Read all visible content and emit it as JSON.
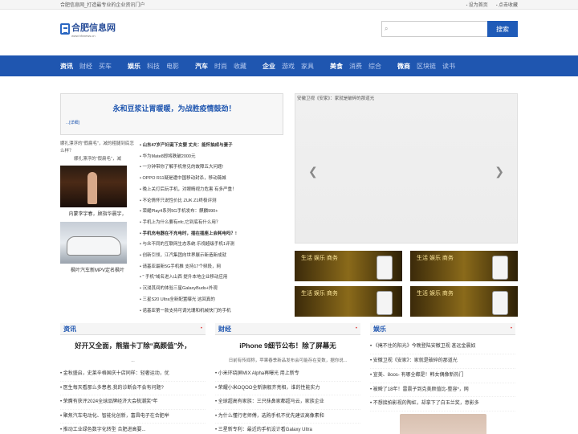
{
  "topbar": {
    "slogan": "合肥信息网_打造最专业的企业资讯门户",
    "set_home": "设为首页",
    "bookmark": "点击收藏"
  },
  "logo": {
    "name": "合肥信息网",
    "url": "www.hfxnews.cn"
  },
  "search": {
    "placeholder": "",
    "button": "搜索"
  },
  "nav": [
    {
      "main": "资讯",
      "subs": [
        "财经",
        "买车"
      ]
    },
    {
      "main": "娱乐",
      "subs": [
        "科技",
        "电影"
      ]
    },
    {
      "main": "汽车",
      "subs": [
        "时尚",
        "收藏"
      ]
    },
    {
      "main": "企业",
      "subs": [
        "游戏",
        "家具"
      ]
    },
    {
      "main": "美食",
      "subs": [
        "消费",
        "综合"
      ]
    },
    {
      "main": "微商",
      "subs": [
        "区块链",
        "读书"
      ]
    }
  ],
  "promo": {
    "title": "永和豆浆让胃暖暖，为战胜疫情鼓劲！",
    "more": "...[详细]"
  },
  "thumbs": {
    "top_caption": "娜扎漂浮的\"假扁毛\"，减的粗腿到底怎么样？",
    "top_caption2": "娜扎漂浮的\"假扁毛\"，减",
    "items": [
      {
        "caption": "内蒙李宇春，顾指华晨宇，"
      },
      {
        "caption": "枫叶汽车新MPV定名枫叶"
      }
    ]
  },
  "news_list": [
    {
      "text": "山东47岁产妇诞下女婴 丈夫：能怀抽成与妻子",
      "bold": true
    },
    {
      "text": "华为Mate8即将跌破2000元",
      "bold": false
    },
    {
      "text": "一分钟带你了解手机常见的故障五大问题!",
      "bold": false
    },
    {
      "text": "OPPO R11疑是遭中国移动封杀，移动薇城",
      "bold": false
    },
    {
      "text": "晚上关灯后玩手机，对眼睛视力危害 有多严重！",
      "bold": false
    },
    {
      "text": "不论情怀只说性价比 ZUK Z1终极评测",
      "bold": false
    },
    {
      "text": "荣耀Play4系列5G手机发布：麒麟990+",
      "bold": false
    },
    {
      "text": "手机上为什么要有nfc,它到底有什么用？",
      "bold": false
    },
    {
      "text": "手机充电器在不充电时，插在插座上会耗电吗？!",
      "bold": true
    },
    {
      "text": "与众不同的互联网生态系统 乐视超级手机1评测",
      "bold": false
    },
    {
      "text": "创新引领，江汽集团向世界展示新造新成就",
      "bold": false
    },
    {
      "text": "请基亚最新5G手机推 支持17个频段，网",
      "bold": false
    },
    {
      "text": "\" 手机\"域名进入山西 提升本地企业移动应用",
      "bold": false
    },
    {
      "text": "沉浸其间的体验三星GalaxyBuds+外观",
      "bold": false
    },
    {
      "text": "三星S20 Ultra全新配置曝光 这回真的",
      "bold": false
    },
    {
      "text": "诺基亚第一款支持可调光珊和机械快门的手机",
      "bold": false
    }
  ],
  "slider": {
    "caption": "安徽卫视《安家》：家就是破碎的那道光"
  },
  "ads": [
    {
      "text": "生活 娱乐 商务"
    },
    {
      "text": "生活 娱乐 商务"
    },
    {
      "text": "生活 娱乐 商务"
    },
    {
      "text": "生活 娱乐 商务"
    }
  ],
  "sections": [
    {
      "title": "资讯",
      "feature": "好开又全面，熊猫卡丁除“高颜值”外，",
      "sub": "...",
      "items": [
        "金秋盛启，史莱辛格国庆十店同样：轻奢运动，优",
        "医生每天看那么多患者,我的诊断会不会有问题?",
        "荣膺有获评2024全球品牌经济大会梳潮奖*年",
        "聚焦汽车电动化、智能化创新，富昌电子在合肥举",
        "推动工业绿色数字化转型 合肥进高要..."
      ]
    },
    {
      "title": "财经",
      "feature": "iPhone 9细节公布！除了屏幕无",
      "sub": "日前有传闻称，苹果春季新品发布会可能存在变数，据你说...",
      "items": [
        "小米环绕屏MIX Alpha再曝光 用上新专",
        "荣耀小米OQOO全新旗舰齐亮相，谁的性能实力",
        "全球超高有家族：三只抹鼻家都超马云，家族企业",
        "为什么懂行老师傅，选购手机不优先建议高像素和",
        "三星新专利：最近的手机设计看Galaxy Ultra"
      ]
    },
    {
      "title": "娱乐",
      "feature": "",
      "sub": "",
      "items": [
        "《掩不住的阳光》今晚登陆安徽卫视 甚远金晨奴",
        "安徽卫视《安家》：家就是破碎的那道光",
        "宣美、8oos- 有哪全都是！韩女偶像新热门",
        "被瞬了18年！雷震子到克美颜值比-整容*，网",
        "不想接拍影视的陶虹，却拿下了白玉兰奖，意影多"
      ]
    }
  ]
}
